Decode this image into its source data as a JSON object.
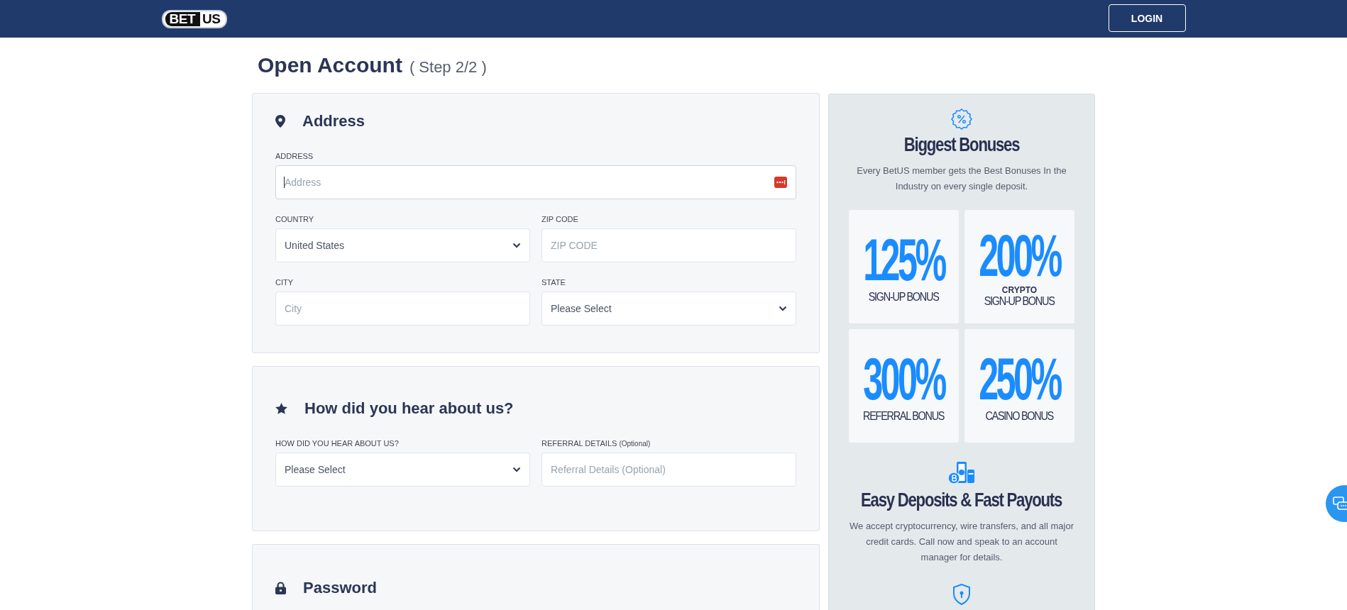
{
  "header": {
    "logo": {
      "part1": "BET",
      "part2": "US"
    },
    "login_button": "LOGIN"
  },
  "page_title": {
    "title": "Open Account",
    "step": "( Step 2/2 )"
  },
  "sections": [
    {
      "title": "Address",
      "rows": [
        [
          {
            "label": "ADDRESS",
            "kind": "text",
            "placeholder": "Address",
            "focused": true,
            "autofill_icon": true
          }
        ],
        [
          {
            "label": "COUNTRY",
            "kind": "select",
            "value": "United States",
            "focused": false
          },
          {
            "label": "ZIP CODE",
            "kind": "text",
            "placeholder": "ZIP CODE",
            "focused": false,
            "autofill_icon": false
          }
        ],
        [
          {
            "label": "CITY",
            "kind": "text",
            "placeholder": "City",
            "focused": false,
            "autofill_icon": false
          },
          {
            "label": "STATE",
            "kind": "select",
            "value": "Please Select",
            "focused": false
          }
        ]
      ]
    },
    {
      "title": "How did you hear about us?",
      "rows": [
        [
          {
            "label": "HOW DID YOU HEAR ABOUT US?",
            "kind": "select",
            "value": "Please Select",
            "focused": false
          },
          {
            "label": "REFERRAL DETAILS",
            "label_note": "(Optional)",
            "kind": "text",
            "placeholder": "Referral Details (Optional)",
            "focused": false,
            "autofill_icon": false
          }
        ]
      ]
    },
    {
      "title": "Password"
    }
  ],
  "sidebar": {
    "bonuses": {
      "title": "Biggest Bonuses",
      "text": "Every BetUS member gets the Best Bonuses In the Industry on every single deposit."
    },
    "tiles": [
      {
        "amount": "125%",
        "label": "SIGN-UP BONUS"
      },
      {
        "amount": "200%",
        "tag": "CRYPTO",
        "label": "SIGN-UP BONUS"
      },
      {
        "amount": "300%",
        "label": "REFERRAL BONUS"
      },
      {
        "amount": "250%",
        "label": "CASINO BONUS"
      }
    ],
    "deposits": {
      "title": "Easy Deposits & Fast Payouts",
      "text": "We accept cryptocurrency, wire transfers, and all major credit cards. Call now and speak to an account manager for details."
    }
  }
}
